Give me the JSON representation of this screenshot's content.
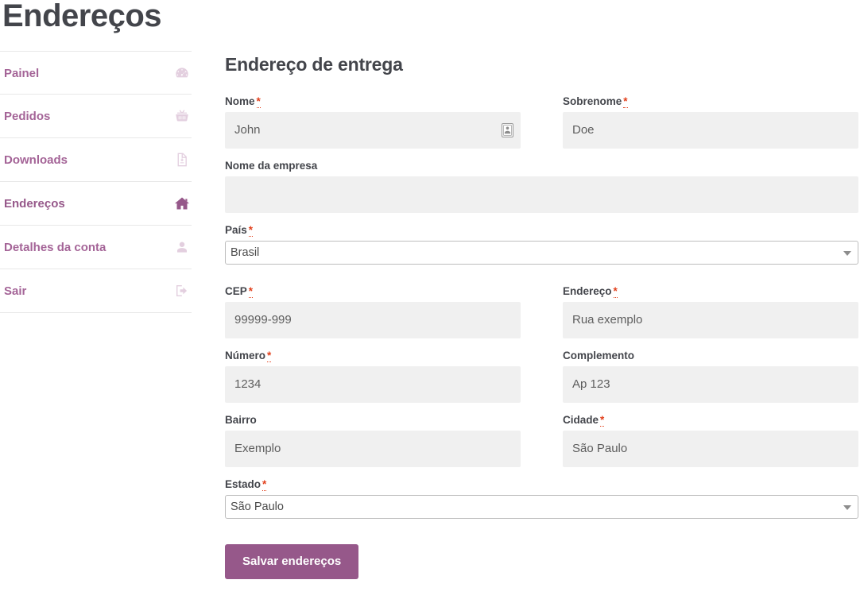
{
  "page": {
    "title": "Endereços"
  },
  "sidebar": {
    "items": [
      {
        "label": "Painel",
        "icon": "dashboard-icon",
        "active": false
      },
      {
        "label": "Pedidos",
        "icon": "basket-icon",
        "active": false
      },
      {
        "label": "Downloads",
        "icon": "download-file-icon",
        "active": false
      },
      {
        "label": "Endereços",
        "icon": "home-icon",
        "active": true
      },
      {
        "label": "Detalhes da conta",
        "icon": "user-icon",
        "active": false
      },
      {
        "label": "Sair",
        "icon": "sign-out-icon",
        "active": false
      }
    ]
  },
  "form": {
    "heading": "Endereço de entrega",
    "required_mark": "*",
    "fields": {
      "first_name": {
        "label": "Nome",
        "value": "John",
        "required": true
      },
      "last_name": {
        "label": "Sobrenome",
        "value": "Doe",
        "required": true
      },
      "company": {
        "label": "Nome da empresa",
        "value": "",
        "required": false
      },
      "country": {
        "label": "País",
        "value": "Brasil",
        "required": true
      },
      "postcode": {
        "label": "CEP",
        "value": "99999-999",
        "required": true
      },
      "address_1": {
        "label": "Endereço",
        "value": "Rua exemplo",
        "required": true
      },
      "number": {
        "label": "Número",
        "value": "1234",
        "required": true
      },
      "address_2": {
        "label": "Complemento",
        "value": "Ap 123",
        "required": false
      },
      "neighborhood": {
        "label": "Bairro",
        "value": "Exemplo",
        "required": false
      },
      "city": {
        "label": "Cidade",
        "value": "São Paulo",
        "required": true
      },
      "state": {
        "label": "Estado",
        "value": "São Paulo",
        "required": true
      }
    },
    "submit_label": "Salvar endereços"
  },
  "colors": {
    "accent": "#96588a",
    "link": "#a46497",
    "heading": "#43454b",
    "required": "#e2401c",
    "input_bg": "#f0f0f0"
  }
}
